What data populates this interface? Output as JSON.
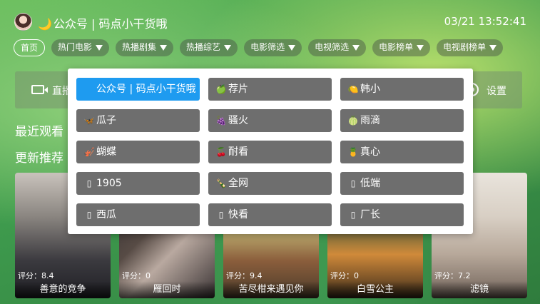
{
  "header": {
    "app_title": "公众号 | 码点小干货哦",
    "clock": "03/21 13:52:41"
  },
  "nav": [
    {
      "label": "首页",
      "dropdown": false
    },
    {
      "label": "热门电影",
      "dropdown": true
    },
    {
      "label": "热播剧集",
      "dropdown": true
    },
    {
      "label": "热播综艺",
      "dropdown": true
    },
    {
      "label": "电影筛选",
      "dropdown": true
    },
    {
      "label": "电视筛选",
      "dropdown": true
    },
    {
      "label": "电影榜单",
      "dropdown": true
    },
    {
      "label": "电视剧榜单",
      "dropdown": true
    }
  ],
  "quick": {
    "live_label": "直播",
    "settings_label": "设置"
  },
  "sections": {
    "recent": "最近观看",
    "recommend": "更新推荐"
  },
  "sources": [
    {
      "label": "公众号 | 码点小干货哦",
      "icon": "",
      "selected": true
    },
    {
      "label": "荐片",
      "icon": "🍏",
      "selected": false
    },
    {
      "label": "韩小",
      "icon": "🍋",
      "selected": false
    },
    {
      "label": "瓜子",
      "icon": "🦋",
      "selected": false
    },
    {
      "label": "骚火",
      "icon": "🍇",
      "selected": false
    },
    {
      "label": "雨滴",
      "icon": "🍈",
      "selected": false
    },
    {
      "label": "蝴蝶",
      "icon": "🎻",
      "selected": false
    },
    {
      "label": "耐看",
      "icon": "🍒",
      "selected": false
    },
    {
      "label": "真心",
      "icon": "🍍",
      "selected": false
    },
    {
      "label": "1905",
      "icon": "▯",
      "selected": false
    },
    {
      "label": "全网",
      "icon": "🍾",
      "selected": false
    },
    {
      "label": "低端",
      "icon": "▯",
      "selected": false
    },
    {
      "label": "西瓜",
      "icon": "▯",
      "selected": false
    },
    {
      "label": "快看",
      "icon": "▯",
      "selected": false
    },
    {
      "label": "厂长",
      "icon": "▯",
      "selected": false
    }
  ],
  "movies": [
    {
      "title": "善意的竞争",
      "score": "评分：8.4"
    },
    {
      "title": "雁回时",
      "score": "评分：0"
    },
    {
      "title": "苦尽柑来遇见你",
      "score": "评分：9.4"
    },
    {
      "title": "白雪公主",
      "score": "评分：0"
    },
    {
      "title": "滤镜",
      "score": "评分：7.2"
    }
  ]
}
